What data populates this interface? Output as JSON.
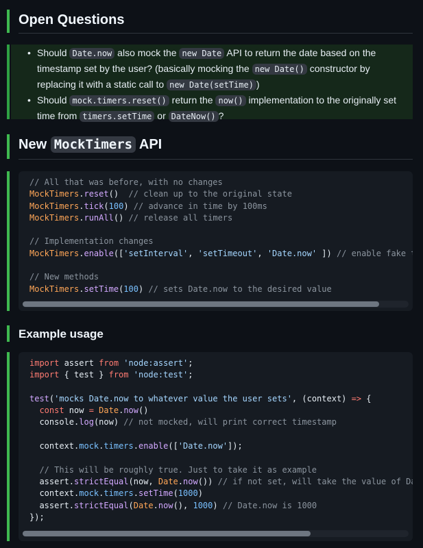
{
  "open_questions": {
    "heading": "Open Questions",
    "q1_parts": [
      "Should ",
      "Date.now",
      " also mock the ",
      "new Date",
      " API to return the date based on the timestamp set by the user? (basically mocking the ",
      "new Date()",
      " constructor by replacing it with a static call to ",
      "new Date(setTime)",
      ")"
    ],
    "q2_parts": [
      "Should ",
      "mock.timers.reset()",
      " return the ",
      "now()",
      " implementation to the originally set time from ",
      "timers.setTime",
      " or ",
      "DateNow()",
      "?"
    ]
  },
  "api_section": {
    "heading_pre": "New ",
    "heading_code": "MockTimers",
    "heading_post": " API",
    "code_lines": [
      "// All that was before, with no changes",
      "MockTimers.reset()  // clean up to the original state",
      "MockTimers.tick(100) // advance in time by 100ms",
      "MockTimers.runAll() // release all timers",
      "",
      "// Implementation changes",
      "MockTimers.enable(['setInterval', 'setTimeout', 'Date.now' ]) // enable fake t",
      "",
      "// New methods",
      "MockTimers.setTime(100) // sets Date.now to the desired value"
    ]
  },
  "example_section": {
    "heading": "Example usage",
    "code_lines": [
      "import assert from 'node:assert';",
      "import { test } from 'node:test';",
      "",
      "test('mocks Date.now to whatever value the user sets', (context) => {",
      "  const now = Date.now()",
      "  console.log(now) // not mocked, will print correct timestamp",
      "",
      "  context.mock.timers.enable(['Date.now']);",
      "",
      "  // This will be roughly true. Just to take it as example",
      "  assert.strictEqual(now, Date.now()) // if not set, will take the value of Da",
      "  context.mock.timers.setTime(1000)",
      "  assert.strictEqual(Date.now(), 1000) // Date.now is 1000",
      "});"
    ]
  },
  "colors": {
    "accent_bar": "#3fb950",
    "background": "#0d1117",
    "code_background": "#161b22"
  }
}
